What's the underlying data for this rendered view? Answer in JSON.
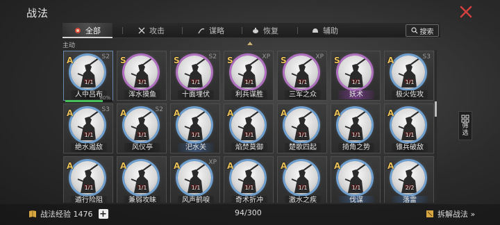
{
  "header": {
    "title": "战法"
  },
  "tabs": [
    {
      "label": "全部",
      "icon": "all-icon",
      "active": true
    },
    {
      "label": "攻击",
      "icon": "swords-icon"
    },
    {
      "label": "谋略",
      "icon": "strategy-icon"
    },
    {
      "label": "恢复",
      "icon": "teapot-icon"
    },
    {
      "label": "辅助",
      "icon": "helmet-icon"
    }
  ],
  "search": {
    "label": "搜索"
  },
  "section": {
    "label": "主动"
  },
  "cards": [
    {
      "grade": "A",
      "corner": "S2",
      "level": "1/1",
      "name": "人中吕布",
      "rarity": "A",
      "nameStyle": "dark",
      "progress": "80%"
    },
    {
      "grade": "S",
      "corner": "",
      "level": "1/1",
      "name": "浑水摸鱼",
      "rarity": "S",
      "nameStyle": "dark"
    },
    {
      "grade": "S",
      "corner": "S2",
      "level": "1/1",
      "name": "十面埋伏",
      "rarity": "S",
      "nameStyle": "dark"
    },
    {
      "grade": "S",
      "corner": "XP",
      "level": "1/1",
      "name": "利兵谋胜",
      "rarity": "S",
      "nameStyle": "dark"
    },
    {
      "grade": "S",
      "corner": "XP",
      "level": "1/1",
      "name": "三军之众",
      "rarity": "S",
      "nameStyle": "dark"
    },
    {
      "grade": "S",
      "corner": "",
      "level": "1/1",
      "name": "妖术",
      "rarity": "S",
      "nameStyle": "purple"
    },
    {
      "grade": "A",
      "corner": "S3",
      "level": "1/1",
      "name": "极火佐攻",
      "rarity": "A",
      "nameStyle": "dark"
    },
    {
      "grade": "A",
      "corner": "S3",
      "level": "1/1",
      "name": "绝水遏敌",
      "rarity": "A",
      "nameStyle": "dark"
    },
    {
      "grade": "A",
      "corner": "S2",
      "level": "1/1",
      "name": "风仪亭",
      "rarity": "A",
      "nameStyle": "dark"
    },
    {
      "grade": "A",
      "corner": "",
      "level": "1/1",
      "name": "汜水关",
      "rarity": "A",
      "nameStyle": "blue"
    },
    {
      "grade": "A",
      "corner": "",
      "level": "1/1",
      "name": "焰焚莫御",
      "rarity": "A",
      "nameStyle": "dark"
    },
    {
      "grade": "A",
      "corner": "",
      "level": "1/1",
      "name": "楚歌四起",
      "rarity": "A",
      "nameStyle": "dark"
    },
    {
      "grade": "A",
      "corner": "",
      "level": "1/1",
      "name": "掎角之势",
      "rarity": "A",
      "nameStyle": "dark"
    },
    {
      "grade": "A",
      "corner": "",
      "level": "1/1",
      "name": "锥兵破敌",
      "rarity": "A",
      "nameStyle": "dark"
    },
    {
      "grade": "A",
      "corner": "",
      "level": "1/1",
      "name": "遁行险阻",
      "rarity": "A",
      "nameStyle": "dark"
    },
    {
      "grade": "A",
      "corner": "",
      "level": "1/1",
      "name": "兼弱攻昧",
      "rarity": "A",
      "nameStyle": "dark"
    },
    {
      "grade": "A",
      "corner": "XP",
      "level": "1/1",
      "name": "风声鹤唳",
      "rarity": "A",
      "nameStyle": "dark"
    },
    {
      "grade": "A",
      "corner": "",
      "level": "1/1",
      "name": "奇术折冲",
      "rarity": "A",
      "nameStyle": "dark"
    },
    {
      "grade": "A",
      "corner": "",
      "level": "1/1",
      "name": "激水之疾",
      "rarity": "A",
      "nameStyle": "dark"
    },
    {
      "grade": "A",
      "corner": "",
      "level": "1/1",
      "name": "伐谋",
      "rarity": "A",
      "nameStyle": "blue"
    },
    {
      "grade": "A",
      "corner": "",
      "level": "2/2",
      "name": "落雷",
      "rarity": "A",
      "nameStyle": "blue"
    }
  ],
  "filter": {
    "label": "筛选"
  },
  "footer": {
    "exp_label": "战法经验 1476",
    "count": "94/300",
    "decompose_label": "拆解战法 »"
  },
  "colors": {
    "gold": "#e8c05a",
    "close_red": "#d04040",
    "progress_green": "#46c05a"
  }
}
